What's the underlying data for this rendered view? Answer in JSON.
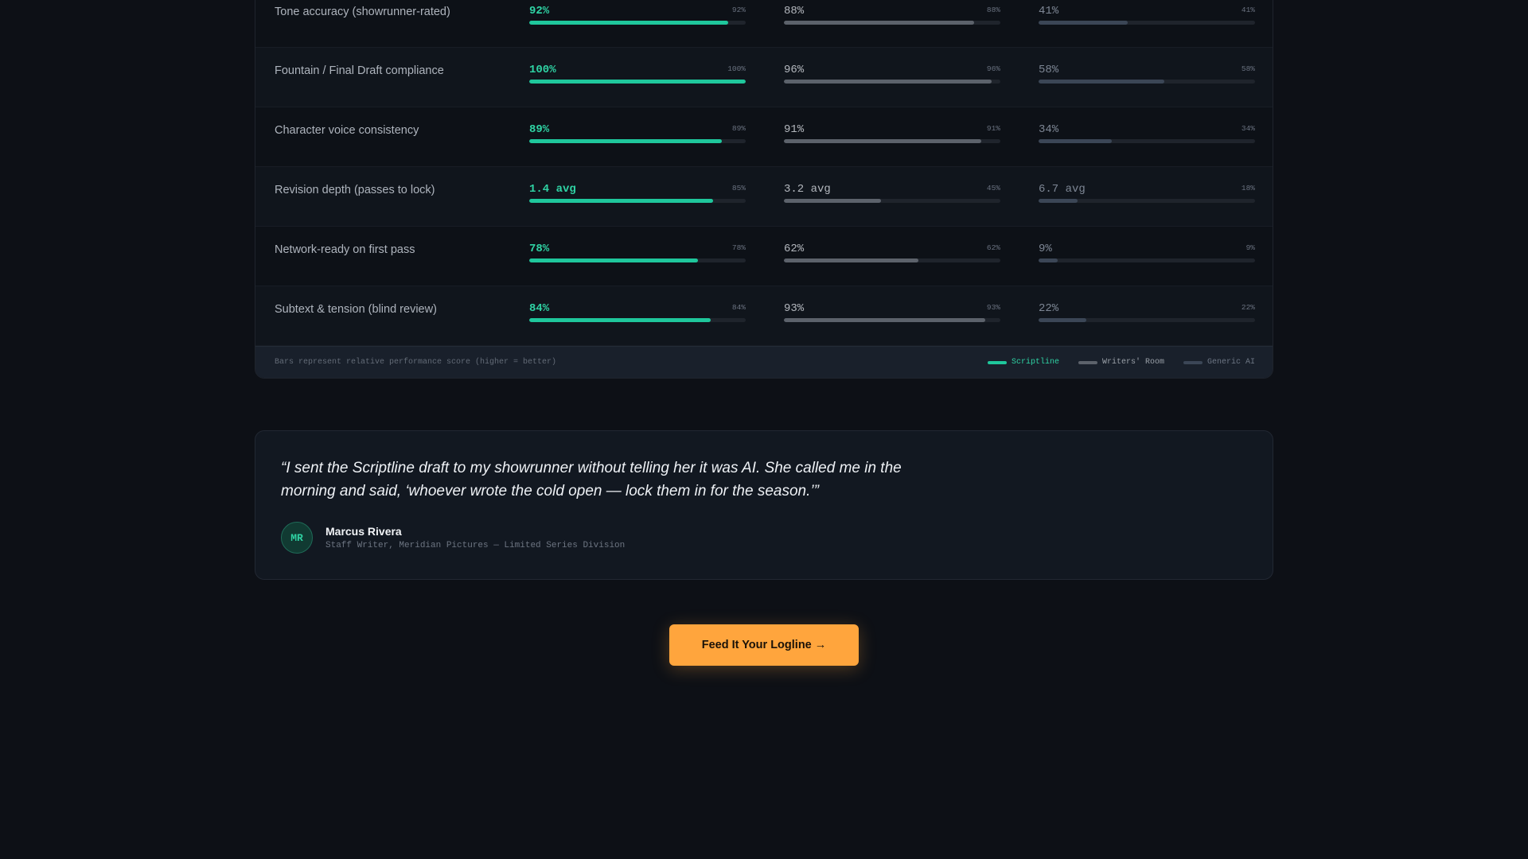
{
  "comparison": {
    "rows": [
      {
        "metric": "Tone accuracy (showrunner-rated)",
        "scriptline": {
          "value": "92%",
          "score": "92%",
          "fill": 0.92
        },
        "writers_room": {
          "value": "88%",
          "score": "88%",
          "fill": 0.88
        },
        "generic_ai": {
          "value": "41%",
          "score": "41%",
          "fill": 0.41
        }
      },
      {
        "metric": "Fountain / Final Draft compliance",
        "scriptline": {
          "value": "100%",
          "score": "100%",
          "fill": 1.0
        },
        "writers_room": {
          "value": "96%",
          "score": "96%",
          "fill": 0.96
        },
        "generic_ai": {
          "value": "58%",
          "score": "58%",
          "fill": 0.58
        }
      },
      {
        "metric": "Character voice consistency",
        "scriptline": {
          "value": "89%",
          "score": "89%",
          "fill": 0.89
        },
        "writers_room": {
          "value": "91%",
          "score": "91%",
          "fill": 0.91
        },
        "generic_ai": {
          "value": "34%",
          "score": "34%",
          "fill": 0.34
        }
      },
      {
        "metric": "Revision depth (passes to lock)",
        "scriptline": {
          "value": "1.4 avg",
          "score": "85%",
          "fill": 0.85
        },
        "writers_room": {
          "value": "3.2 avg",
          "score": "45%",
          "fill": 0.45
        },
        "generic_ai": {
          "value": "6.7 avg",
          "score": "18%",
          "fill": 0.18
        }
      },
      {
        "metric": "Network-ready on first pass",
        "scriptline": {
          "value": "78%",
          "score": "78%",
          "fill": 0.78
        },
        "writers_room": {
          "value": "62%",
          "score": "62%",
          "fill": 0.62
        },
        "generic_ai": {
          "value": "9%",
          "score": "9%",
          "fill": 0.09
        }
      },
      {
        "metric": "Subtext & tension (blind review)",
        "scriptline": {
          "value": "84%",
          "score": "84%",
          "fill": 0.84
        },
        "writers_room": {
          "value": "93%",
          "score": "93%",
          "fill": 0.93
        },
        "generic_ai": {
          "value": "22%",
          "score": "22%",
          "fill": 0.22
        }
      }
    ],
    "footnote": "Bars represent relative performance score (higher = better)",
    "legend": {
      "scriptline": "Scriptline",
      "writers_room": "Writers' Room",
      "generic_ai": "Generic AI"
    },
    "colors": {
      "scriptline": "#1fc79c",
      "writers_room": "#5c626b",
      "generic_ai": "#3b4656"
    }
  },
  "testimonial": {
    "quote": "“I sent the Scriptline draft to my showrunner without telling her it was AI. She called me in the morning and said, ‘whoever wrote the cold open — lock them in for the season.’”",
    "initials": "MR",
    "name": "Marcus Rivera",
    "role": "Staff Writer, Meridian Pictures — Limited Series Division"
  },
  "cta": {
    "label": "Feed It Your Logline →",
    "color": "#ffa53d"
  }
}
